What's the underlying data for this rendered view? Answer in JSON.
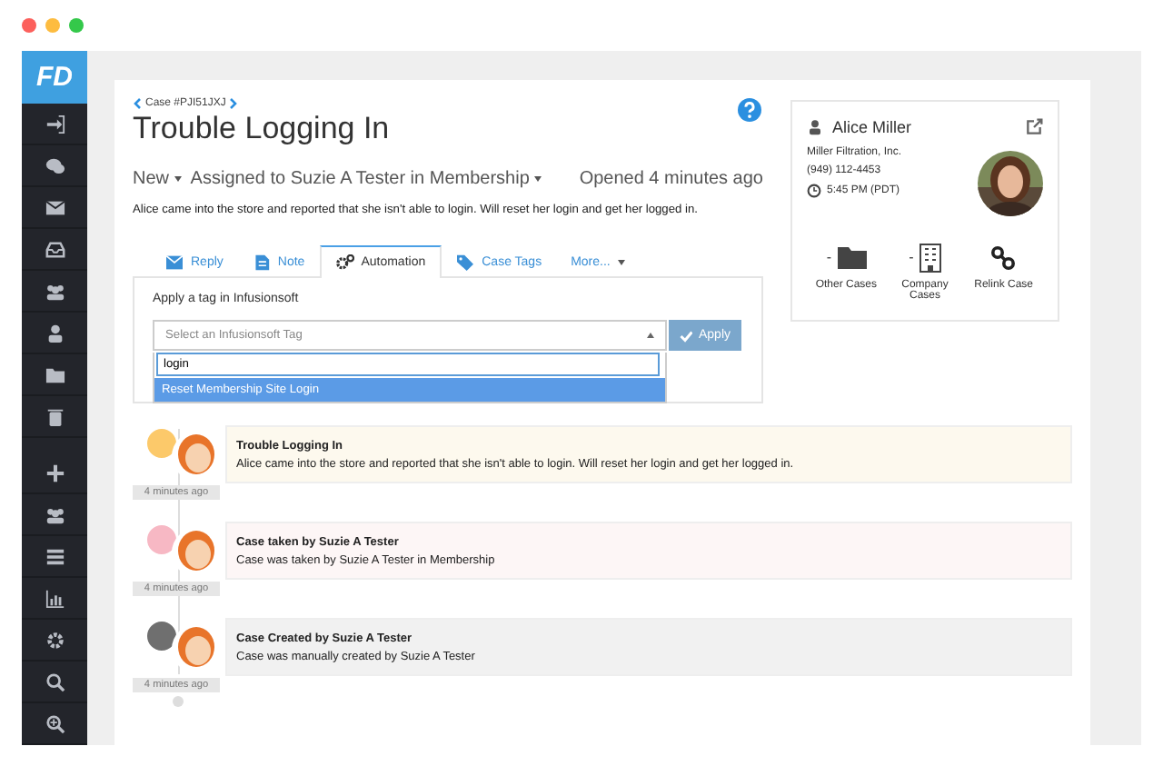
{
  "sidebar": {
    "logo": "FD"
  },
  "case": {
    "id": "Case #PJI51JXJ",
    "title": "Trouble Logging In",
    "status": "New",
    "assignment": "Assigned to Suzie A Tester in Membership",
    "opened": "Opened 4 minutes ago",
    "description": "Alice came into the store and reported that she isn't able to login. Will reset her login and get her logged in."
  },
  "tabs": [
    {
      "label": "Reply",
      "selected": false
    },
    {
      "label": "Note",
      "selected": false
    },
    {
      "label": "Automation",
      "selected": true
    },
    {
      "label": "Case Tags",
      "selected": false
    },
    {
      "label": "More...",
      "selected": false
    }
  ],
  "automation": {
    "label": "Apply a tag in Infusionsoft",
    "select_placeholder": "Select an Infusionsoft Tag",
    "search_value": "login",
    "options": [
      {
        "label": "Reset Membership Site Login",
        "selected": true
      }
    ],
    "apply_button": "Apply"
  },
  "contact": {
    "name": "Alice Miller",
    "company": "Miller Filtration, Inc.",
    "phone": "(949) 112-4453",
    "local_time": "5:45 PM (PDT)",
    "actions": [
      {
        "count": "-",
        "label": "Other Cases"
      },
      {
        "count": "-",
        "label": "Company Cases"
      },
      {
        "label": "Relink Case"
      }
    ]
  },
  "timeline": [
    {
      "kind": "note",
      "color": "#fcc96a",
      "title": "Trouble Logging In",
      "text": "Alice came into the store and reported that she isn't able to login. Will reset her login and get her logged in.",
      "time": "4 minutes ago"
    },
    {
      "kind": "transfer",
      "color": "#f7b8c4",
      "title": "Case taken by Suzie A Tester",
      "text": "Case was taken by Suzie A Tester in Membership",
      "time": "4 minutes ago"
    },
    {
      "kind": "created",
      "color": "#6f6f6f",
      "title": "Case Created by Suzie A Tester",
      "text": "Case was manually created by Suzie A Tester",
      "time": "4 minutes ago"
    }
  ]
}
